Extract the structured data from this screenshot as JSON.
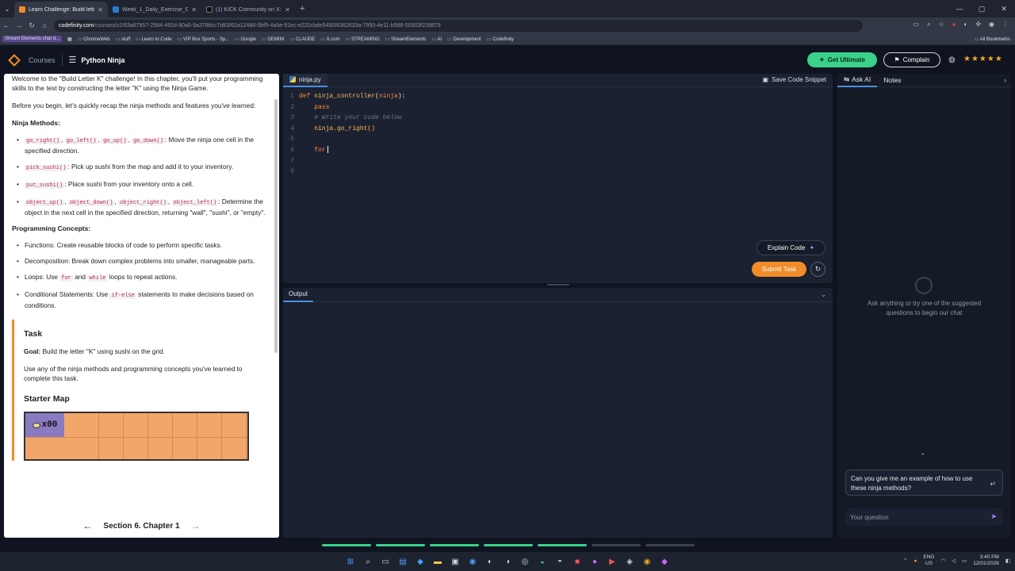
{
  "browser": {
    "tabs": [
      {
        "title": "Learn Challenge: Build letter K |",
        "active": true,
        "icon_color": "#f28c28"
      },
      {
        "title": "Week_1_Daily_Exercise_Guide.d",
        "active": false,
        "icon_color": "#2b7cd3"
      },
      {
        "title": "(1) KICK Community on X: \"@p",
        "active": false,
        "icon_color": "#cccccc"
      }
    ],
    "url_host": "codefinity.com",
    "url_path": "/courses/v2/63a87957-2584-492d-80a0-9a3788cc7d83/62a12486-5bf9-4a5e-91ec-e220cbde5450/6362633a-7950-4e11-b588-50503f239879",
    "bookmarks": [
      "Stream Elements chat d...",
      "ChromeWeb",
      "stuff",
      "Learn to Code",
      "VIP Box Sports - Sp...",
      "Google",
      "GEMINI",
      "CLAUDE",
      "X.com",
      "STREAMING",
      "StreamElements",
      "AI",
      "Development",
      "Codefinity"
    ],
    "all_bookmarks": "All Bookmarks"
  },
  "header": {
    "courses": "Courses",
    "course_name": "Python Ninja",
    "get_ultimate": "Get Ultimate",
    "complain": "Complain",
    "rating_stars": "★★★★★"
  },
  "lesson": {
    "intro": "Welcome to the \"Build Letter K\" challenge! In this chapter, you'll put your programming skills to the test by constructing the letter \"K\" using the Ninja Game.",
    "recap": "Before you begin, let's quickly recap the ninja methods and features you've learned:",
    "methods_heading": "Ninja Methods:",
    "m1_codes": [
      "go_right()",
      "go_left()",
      "go_up()",
      "go_down()"
    ],
    "m1_text": ": Move the ninja one cell in the specified direction.",
    "m2_code": "pick_sushi()",
    "m2_text": ": Pick up sushi from the map and add it to your inventory.",
    "m3_code": "put_sushi()",
    "m3_text": ": Place sushi from your inventory onto a cell.",
    "m4_codes": [
      "object_up()",
      "object_down()",
      "object_right()",
      "object_left()"
    ],
    "m4_text": ": Determine the object in the next cell in the specified direction, returning \"wall\", \"sushi\", or \"empty\".",
    "concepts_heading": "Programming Concepts:",
    "c1": "Functions: Create reusable blocks of code to perform specific tasks.",
    "c2": "Decomposition: Break down complex problems into smaller, manageable parts.",
    "c3_pre": "Loops: Use ",
    "c3_code1": "for",
    "c3_mid": " and ",
    "c3_code2": "while",
    "c3_post": " loops to repeat actions.",
    "c4_pre": "Conditional Statements: Use ",
    "c4_code": "if-else",
    "c4_post": " statements to make decisions based on conditions.",
    "task_heading": "Task",
    "goal_label": "Goal:",
    "goal_text": " Build the letter \"K\" using sushi on the grid.",
    "task_text": "Use any of the ninja methods and programming concepts you've learned to complete this task.",
    "starter_map": "Starter Map",
    "map_counter": "x00",
    "footer": "Section 6. Chapter 1"
  },
  "editor": {
    "filename": "ninja.py",
    "save_snippet": "Save Code Snippet",
    "line_numbers": [
      "1",
      "2",
      "3",
      "4",
      "5",
      "6",
      "7",
      "8"
    ],
    "def_kw": "def",
    "func_name": "ninja_controller",
    "param": "ninja",
    "pass_kw": "pass",
    "comment": "# Write your code below",
    "call": "ninja.go_right()",
    "for_kw": "for",
    "explain": "Explain Code",
    "submit": "Submit Task"
  },
  "output": {
    "tab": "Output"
  },
  "ai": {
    "tab_ask": "Ask AI",
    "tab_notes": "Notes",
    "empty_text": "Ask anything or try one of the suggested questions to begin our chat",
    "suggestion": "Can you give me an example of how to use these ninja methods?",
    "placeholder": "Your question"
  },
  "progress": {
    "done": 5,
    "total": 7
  },
  "tray": {
    "lang": "ENG",
    "region": "US",
    "time": "3:40 PM",
    "date": "12/01/2026"
  }
}
